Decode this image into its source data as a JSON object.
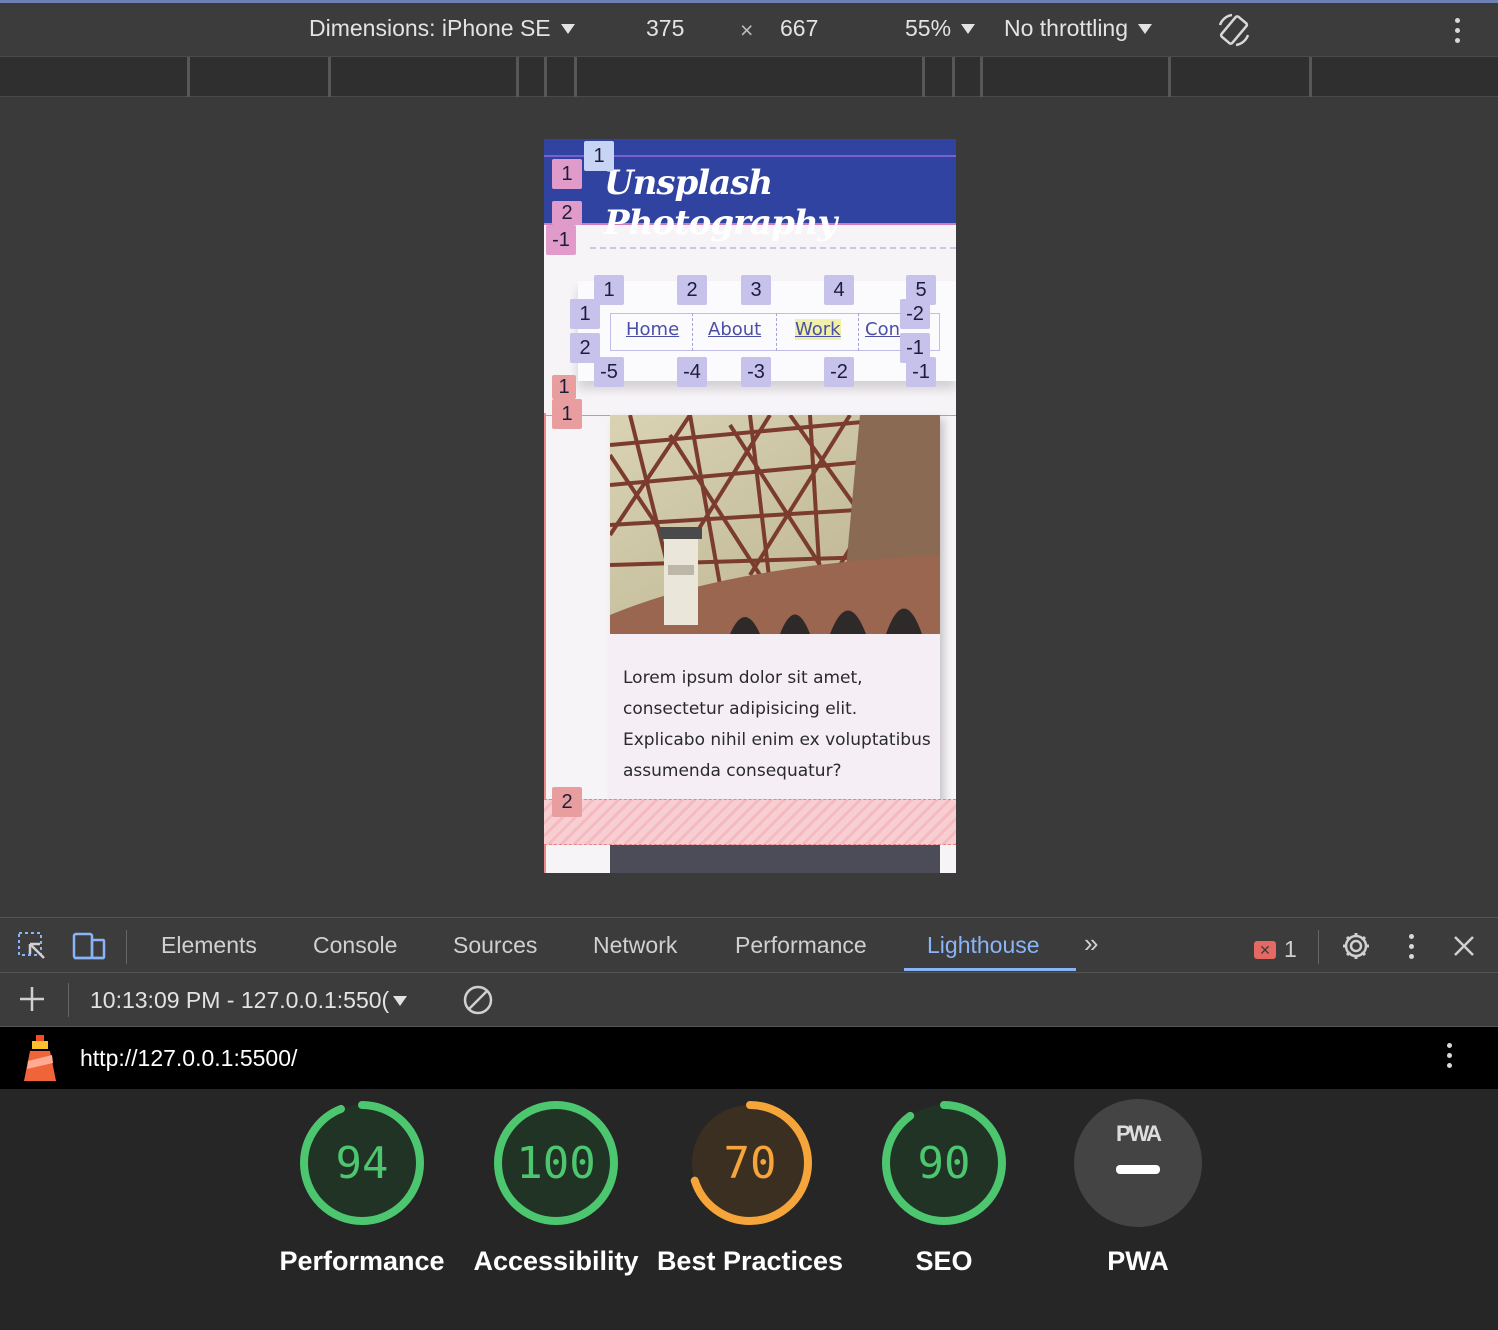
{
  "device_toolbar": {
    "dimensions_label": "Dimensions: iPhone SE",
    "width": "375",
    "times": "×",
    "height": "667",
    "zoom": "55%",
    "throttling": "No throttling"
  },
  "site": {
    "title": "Unsplash Photography",
    "nav": [
      "Home",
      "About",
      "Work",
      "Con"
    ],
    "card_text": "Lorem ipsum dolor sit amet, consectetur adipisicing elit. Explicabo nihil enim ex voluptatibus assumenda consequatur?"
  },
  "overlay_badges": {
    "header_col": "1",
    "header_rows": [
      "1",
      "2",
      "-1"
    ],
    "nav_cols_top": [
      "1",
      "2",
      "3",
      "4",
      "5"
    ],
    "nav_cols_bottom": [
      "-5",
      "-4",
      "-3",
      "-2",
      "-1"
    ],
    "nav_rows_left": [
      "1",
      "2"
    ],
    "nav_rows_right": [
      "-2",
      "-1"
    ],
    "main_col": "1",
    "main_rows": [
      "1",
      "2"
    ]
  },
  "devtools": {
    "tabs": [
      "Elements",
      "Console",
      "Sources",
      "Network",
      "Performance",
      "Lighthouse"
    ],
    "active_tab": "Lighthouse",
    "error_count": "1",
    "report_time": "10:13:09 PM - 127.0.0.1:550(",
    "url": "http://127.0.0.1:5500/"
  },
  "lighthouse": {
    "scores": [
      {
        "label": "Performance",
        "value": "94",
        "pct": 94,
        "color": "#4cc66f"
      },
      {
        "label": "Accessibility",
        "value": "100",
        "pct": 100,
        "color": "#4cc66f"
      },
      {
        "label": "Best Practices",
        "value": "70",
        "pct": 70,
        "color": "#f5a53a"
      },
      {
        "label": "SEO",
        "value": "90",
        "pct": 90,
        "color": "#4cc66f"
      }
    ],
    "pwa": {
      "label": "PWA",
      "badge": "PWA"
    }
  }
}
